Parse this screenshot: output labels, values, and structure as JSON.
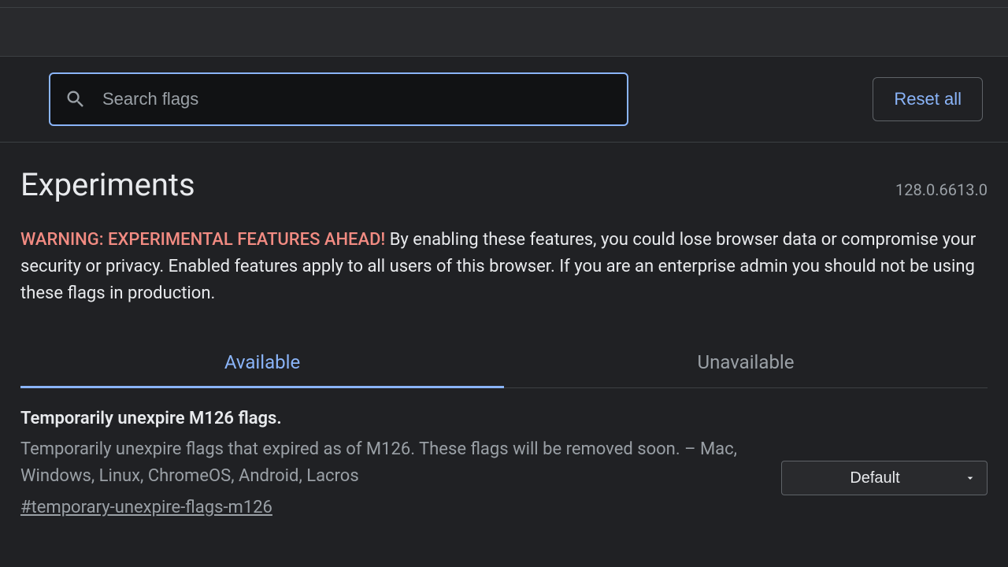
{
  "search": {
    "placeholder": "Search flags"
  },
  "reset_label": "Reset all",
  "header": {
    "title": "Experiments",
    "version": "128.0.6613.0"
  },
  "warning": {
    "prefix": "WARNING: EXPERIMENTAL FEATURES AHEAD!",
    "body": "By enabling these features, you could lose browser data or compromise your security or privacy. Enabled features apply to all users of this browser. If you are an enterprise admin you should not be using these flags in production."
  },
  "tabs": {
    "available": "Available",
    "unavailable": "Unavailable"
  },
  "flags": [
    {
      "title": "Temporarily unexpire M126 flags.",
      "description": "Temporarily unexpire flags that expired as of M126. These flags will be removed soon. – Mac, Windows, Linux, ChromeOS, Android, Lacros",
      "anchor": "#temporary-unexpire-flags-m126",
      "selected": "Default"
    }
  ]
}
